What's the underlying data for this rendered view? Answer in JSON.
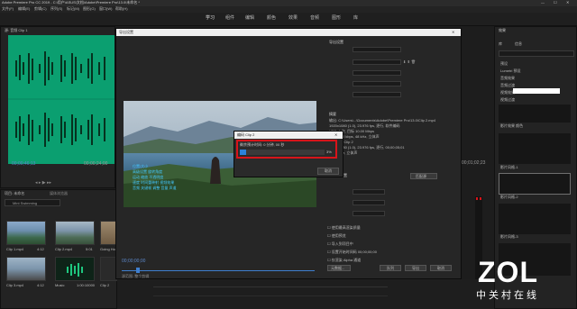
{
  "titlebar": {
    "text": "Adobe Premiere Pro CC 2019 - C:\\用户\\ASUS\\文档\\Adobe\\Premiere Pro\\13.0\\未命名 *"
  },
  "menu": [
    "文件(F)",
    "编辑(E)",
    "剪辑(C)",
    "序列(S)",
    "标记(M)",
    "图形(G)",
    "窗口(W)",
    "帮助(H)"
  ],
  "workspaces": [
    "学习",
    "组件",
    "编辑",
    "颜色",
    "效果",
    "音频",
    "图形",
    "库"
  ],
  "source": {
    "title": "源: 音频 Clip 1",
    "timecode_left": "00;00;46;13",
    "timecode_right": "00;00;24;00"
  },
  "project": {
    "title": "项目: 未命名",
    "tab": "媒体浏览器",
    "search": "Mint Swimming",
    "items": [
      {
        "name": "Clip 1.mp4",
        "duration": "4:12"
      },
      {
        "name": "Clip 2.mp4",
        "duration": "5:01"
      },
      {
        "name": "Going Home",
        "duration": ""
      },
      {
        "name": "Clip 3.mp4",
        "duration": "4:12"
      },
      {
        "name": "Music",
        "duration": "1:00:10000"
      },
      {
        "name": "Clip 2",
        "duration": "5:01"
      }
    ]
  },
  "export_dialog": {
    "title": "导出设置",
    "export_settings_header": "导出设置",
    "summary_header": "摘要",
    "summary_output": "输出: C:\\Users\\...\\Documents\\Adobe\\Premiere Pro\\13.0\\Clip 2.mp4",
    "summary_line1": "1920x1080 (1.0), 23.976 fps, 逐行, 软件编码",
    "summary_line2": "VBR, 1 次, 目标 10.00 Mbps",
    "summary_line3": "AAC, 320 kbps, 48 kHz, 立体声",
    "summary_source": "源: 剪辑, Clip 2",
    "summary_source1": "1920x1080 (1.0), 23.976 fps, 逐行, 00;00;05;01",
    "summary_source2": "48000 Hz, 立体声",
    "video_tab": "视频",
    "basic_settings": "基本视频设置",
    "match_source_btn": "匹配源",
    "checkbox_labels": [
      "使用最高渲染质量",
      "使用预览",
      "导入到项目中",
      "设置开始时间码",
      "仅渲染 Alpha 通道"
    ],
    "timecode_start": "00;00;00;00",
    "metadata_btn": "元数据...",
    "queue_btn": "队列",
    "export_btn": "导出",
    "cancel_btn": "取消"
  },
  "progress_dialog": {
    "title": "编码 Clip 2",
    "remaining": "剩余预计时间: 0 分钟, 00 秒",
    "percent": "3%",
    "progress": 0.07,
    "cancel": "取消"
  },
  "preview": {
    "overlay_lines": [
      "位置/大小",
      "高级设置 旋转角度",
      "运动 缩放 不透明度",
      "速度 时间重映射 视频效果",
      "音频 关键帧 调整 音量 声道"
    ],
    "source_range": "源范围: 整个剪辑",
    "timecode": "00;00;00;00"
  },
  "program": {
    "timecode": "00;01;02;23"
  },
  "effects": {
    "title": "效果",
    "tabs": [
      "库",
      "信息"
    ],
    "items": [
      "预设",
      "Lumetri 预设",
      "音频效果",
      "音频过渡",
      "视频效果",
      "视频过渡"
    ],
    "thumb_labels": [
      "影片效果 颜色",
      "影片风格-1",
      "影片风格-2",
      "影片风格-3"
    ]
  },
  "watermark": {
    "logo": "ZOL",
    "sub": "中关村在线"
  },
  "colors": {
    "waveform_bg": "#0b9f70",
    "accent_blue": "#2a82da",
    "highlight_red": "#d7141a"
  }
}
